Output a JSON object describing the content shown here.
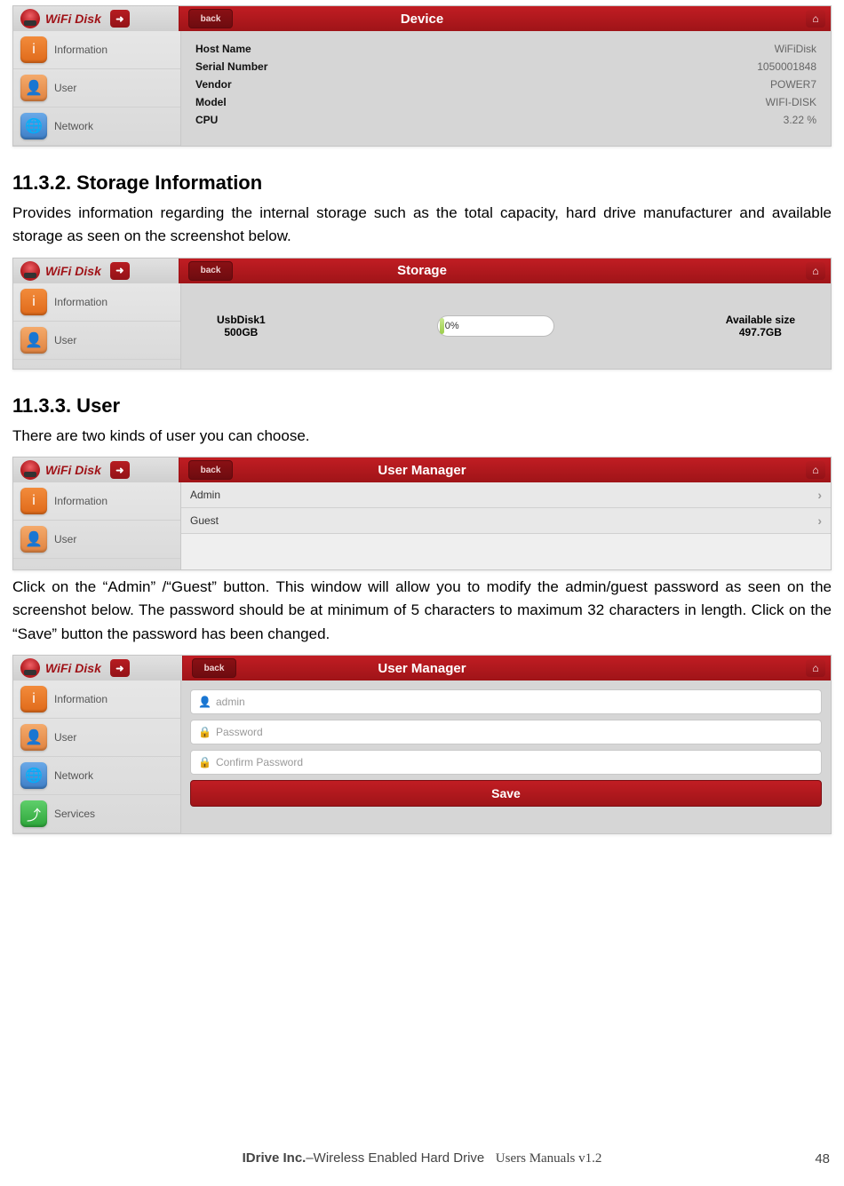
{
  "brand": "WiFi Disk",
  "back": "back",
  "screenshots": {
    "device": {
      "title": "Device",
      "sidebar": [
        "Information",
        "User",
        "Network"
      ],
      "rows": [
        {
          "k": "Host Name",
          "v": "WiFiDisk"
        },
        {
          "k": "Serial Number",
          "v": "1050001848"
        },
        {
          "k": "Vendor",
          "v": "POWER7"
        },
        {
          "k": "Model",
          "v": "WIFI-DISK"
        },
        {
          "k": "CPU",
          "v": "3.22 %"
        }
      ]
    },
    "storage": {
      "title": "Storage",
      "sidebar": [
        "Information",
        "User"
      ],
      "disk_label": "UsbDisk1",
      "disk_size": "500GB",
      "pct": "0%",
      "avail_label": "Available size",
      "avail": "497.7GB"
    },
    "um": {
      "title": "User Manager",
      "sidebar": [
        "Information",
        "User"
      ],
      "rows": [
        "Admin",
        "Guest"
      ]
    },
    "umform": {
      "title": "User Manager",
      "sidebar": [
        "Information",
        "User",
        "Network",
        "Services"
      ],
      "username": "admin",
      "ph_pass": "Password",
      "ph_conf": "Confirm Password",
      "save": "Save"
    }
  },
  "sections": {
    "s2_title": "11.3.2. Storage Information",
    "s2_body": "Provides information regarding the internal storage such as the total capacity,  hard drive manufacturer and available storage as seen on the screenshot below.",
    "s3_title": "11.3.3. User",
    "s3_body": "There are two kinds of user you can choose.",
    "s3_body2": "Click on the “Admin” /“Guest” button. This window will allow you to modify the admin/guest password as seen on the screenshot below.  The password should be at minimum of 5 characters to maximum 32 characters in length.   Click on the “Save” button the password has been changed."
  },
  "footer": {
    "company": "IDrive Inc.",
    "product": "–Wireless Enabled Hard Drive",
    "manual": "Users Manuals v1.2",
    "page": "48"
  }
}
